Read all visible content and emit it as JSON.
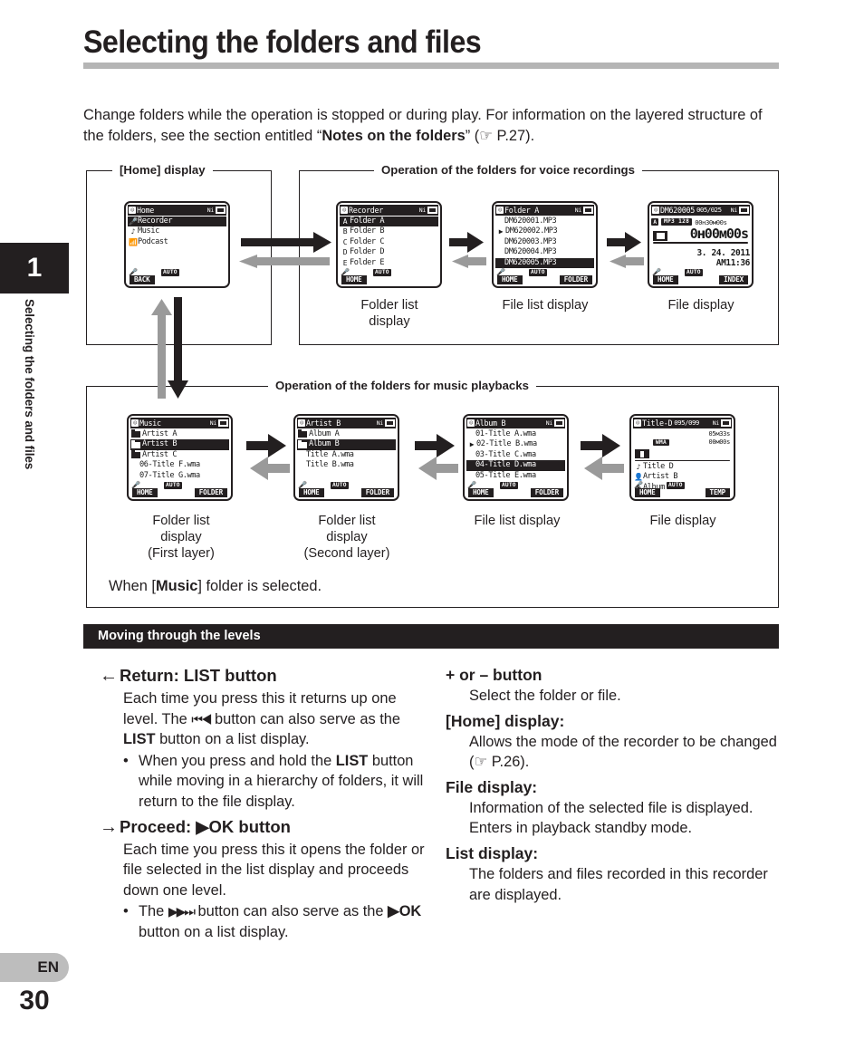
{
  "sidebar": {
    "chapter_number": "1",
    "chapter_title": "Selecting the folders and files",
    "language_badge": "EN",
    "page_number": "30"
  },
  "page": {
    "title": "Selecting the folders and files",
    "intro_part1": "Change folders while the operation is stopped or during play. For information on the layered structure of the folders, see the section entitled “",
    "intro_bold": "Notes on the folders",
    "intro_part2": "” (☞ P.27)."
  },
  "panels": {
    "home_label": "[Home] display",
    "voice_label": "Operation of the folders for voice recordings",
    "music_label": "Operation of the folders for music playbacks",
    "when_music_pre": "When [",
    "when_music_bold": "Music",
    "when_music_post": "] folder is selected."
  },
  "screens": {
    "home": {
      "title": "Home",
      "ni": "Ni",
      "rows": [
        {
          "icon": "mic-icon",
          "label": "Recorder",
          "selected": true
        },
        {
          "icon": "music-note-icon",
          "label": "Music",
          "selected": false
        },
        {
          "icon": "podcast-icon",
          "label": "Podcast",
          "selected": false
        }
      ],
      "auto": "AUTO",
      "softkey_left": "BACK"
    },
    "recorder_folders": {
      "title": "Recorder",
      "ni": "Ni",
      "rows": [
        {
          "icon": "A",
          "label": "Folder A",
          "selected": true
        },
        {
          "icon": "B",
          "label": "Folder B",
          "selected": false
        },
        {
          "icon": "C",
          "label": "Folder C",
          "selected": false
        },
        {
          "icon": "D",
          "label": "Folder D",
          "selected": false
        },
        {
          "icon": "E",
          "label": "Folder E",
          "selected": false
        }
      ],
      "auto": "AUTO",
      "softkey_left": "HOME"
    },
    "folder_a_files": {
      "title": "Folder A",
      "ni": "Ni",
      "rows": [
        {
          "icon": "",
          "label": "DM620001.MP3",
          "selected": false
        },
        {
          "icon": "play",
          "label": "DM620002.MP3",
          "selected": false
        },
        {
          "icon": "",
          "label": "DM620003.MP3",
          "selected": false
        },
        {
          "icon": "",
          "label": "DM620004.MP3",
          "selected": false
        },
        {
          "icon": "",
          "label": "DM620005.MP3",
          "selected": true
        }
      ],
      "auto": "AUTO",
      "softkey_left": "HOME",
      "softkey_right": "FOLDER"
    },
    "voice_file_display": {
      "title": "DM620005",
      "count": "005/025",
      "ni": "Ni",
      "folder_chip": "A",
      "format": "MP3 128",
      "remain": "00н30м00s",
      "big_time": "0ʜ00м00ѕ",
      "date": "3. 24. 2011",
      "time": "AM11:36",
      "auto": "AUTO",
      "softkey_left": "HOME",
      "softkey_right": "INDEX"
    },
    "music_folders": {
      "title": "Music",
      "ni": "Ni",
      "rows": [
        {
          "icon": "folder",
          "label": "Artist A",
          "selected": false
        },
        {
          "icon": "folder",
          "label": "Artist B",
          "selected": true
        },
        {
          "icon": "folder",
          "label": "Artist C",
          "selected": false
        },
        {
          "icon": "",
          "label": "06-Title F.wma",
          "selected": false
        },
        {
          "icon": "",
          "label": "07-Title G.wma",
          "selected": false
        }
      ],
      "auto": "AUTO",
      "softkey_left": "HOME",
      "softkey_right": "FOLDER"
    },
    "artist_b_folders": {
      "title": "Artist B",
      "ni": "Ni",
      "rows": [
        {
          "icon": "folder",
          "label": "Album A",
          "selected": false
        },
        {
          "icon": "folder",
          "label": "Album B",
          "selected": true
        },
        {
          "icon": "",
          "label": "Title A.wma",
          "selected": false
        },
        {
          "icon": "",
          "label": "Title B.wma",
          "selected": false
        }
      ],
      "auto": "AUTO",
      "softkey_left": "HOME",
      "softkey_right": "FOLDER"
    },
    "album_b_files": {
      "title": "Album B",
      "ni": "Ni",
      "rows": [
        {
          "icon": "",
          "label": "01-Title A.wma",
          "selected": false
        },
        {
          "icon": "play",
          "label": "02-Title B.wma",
          "selected": false
        },
        {
          "icon": "",
          "label": "03-Title C.wma",
          "selected": false
        },
        {
          "icon": "",
          "label": "04-Title D.wma",
          "selected": true
        },
        {
          "icon": "",
          "label": "05-Title E.wma",
          "selected": false
        }
      ],
      "auto": "AUTO",
      "softkey_left": "HOME",
      "softkey_right": "FOLDER"
    },
    "music_file_display": {
      "title": "Title-D",
      "count": "095/099",
      "ni": "Ni",
      "format": "WMA",
      "total_time": "05м33ѕ",
      "elapsed_time": "00м00ѕ",
      "meta": [
        {
          "icon": "music-note-icon",
          "label": "Title D"
        },
        {
          "icon": "person-icon",
          "label": "Artist B"
        },
        {
          "icon": "disc-icon",
          "label": "Album B"
        }
      ],
      "auto": "AUTO",
      "softkey_left": "HOME",
      "softkey_right": "TEMP"
    }
  },
  "captions": {
    "voice_folder_list": "Folder list\ndisplay",
    "voice_file_list": "File list display",
    "voice_file_display": "File display",
    "music_folder_list_1": "Folder list\ndisplay\n(First layer)",
    "music_folder_list_2": "Folder list\ndisplay\n(Second layer)",
    "music_file_list": "File list display",
    "music_file_display": "File display"
  },
  "section": {
    "bar_title": "Moving through the levels"
  },
  "left_column": {
    "h1_arrow": "←",
    "h1_pre": "Return: ",
    "h1_bold": "LIST",
    "h1_post": " button",
    "p1_a": "Each time you press this it returns up one level. The ",
    "p1_glyph": "⏮◀",
    "p1_b": " button can also serve as the ",
    "p1_bold": "LIST",
    "p1_c": " button on a list display.",
    "b1_a": "When you press and hold the ",
    "b1_bold": "LIST",
    "b1_b": " button while moving in a hierarchy of folders, it will return to the file display.",
    "h2_arrow": "→",
    "h2_pre": "Proceed: ",
    "h2_glyph": "▶",
    "h2_post": "OK button",
    "p2": "Each time you press this it opens the folder or file selected in the list display and proceeds down one level.",
    "b2_a": "The ",
    "b2_glyph": "▶▶⏭",
    "b2_b": " button can also serve as the ",
    "b2_glyph2": "▶",
    "b2_bold": "OK",
    "b2_c": " button on a list display."
  },
  "right_column": {
    "h1": "+ or – button",
    "p1": "Select the folder or file.",
    "h2_pre": "[",
    "h2_bold": "Home",
    "h2_post": "] display:",
    "p2": "Allows the mode of the recorder to be changed (☞ P.26).",
    "h3": "File display:",
    "p3": "Information of the selected file is displayed. Enters in playback standby mode.",
    "h4": "List display:",
    "p4": "The folders and files recorded in this recorder are displayed."
  }
}
